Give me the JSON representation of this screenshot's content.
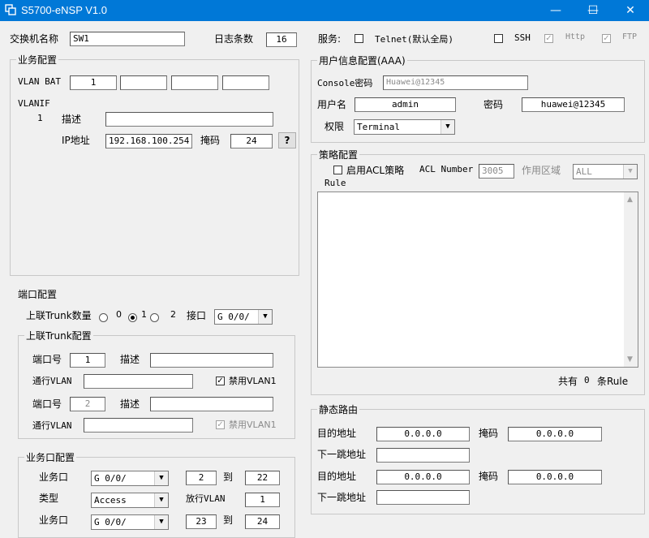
{
  "window": {
    "title": "S5700-eNSP V1.0",
    "minimize": "—",
    "maximize": "☐",
    "close": "✕"
  },
  "top": {
    "switch_name_label": "交换机名称",
    "switch_name_value": "SW1",
    "log_count_label": "日志条数",
    "log_count_value": "16",
    "services_label": "服务:",
    "telnet_label": "Telnet(默认全局)",
    "telnet_checked": false,
    "ssh_label": "SSH",
    "ssh_checked": false,
    "http_label": "Http",
    "http_checked": true,
    "ftp_label": "FTP",
    "ftp_checked": true
  },
  "business": {
    "title": "业务配置",
    "vlan_bat_label": "VLAN BAT",
    "vlan_bat_values": [
      "1",
      "",
      "",
      ""
    ],
    "vlanif_label": "VLANIF",
    "vlanif_number": "1",
    "desc_label": "描述",
    "desc_value": "",
    "ip_label": "IP地址",
    "ip_value": "192.168.100.254",
    "mask_label": "掩码",
    "mask_value": "24",
    "help_label": "?"
  },
  "port_config": {
    "title": "端口配置",
    "uplink_count_label": "上联Trunk数量",
    "options": [
      "0",
      "1",
      "2"
    ],
    "selected": "1",
    "port_label": "接口",
    "port_value": "G 0/0/"
  },
  "uplink_trunk": {
    "title": "上联Trunk配置",
    "rows": [
      {
        "port_label": "端口号",
        "port": "1",
        "desc_label": "描述",
        "desc": "",
        "allow_label": "通行VLAN",
        "allow": "",
        "disable_label": "禁用VLAN1",
        "disable_checked": true,
        "disabled": false
      },
      {
        "port_label": "端口号",
        "port": "2",
        "desc_label": "描述",
        "desc": "",
        "allow_label": "通行VLAN",
        "allow": "",
        "disable_label": "禁用VLAN1",
        "disable_checked": true,
        "disabled": true
      }
    ]
  },
  "service_port": {
    "title": "业务口配置",
    "port_label": "业务口",
    "port1": "G 0/0/",
    "from1": "2",
    "to_label": "到",
    "to1": "22",
    "type_label": "类型",
    "type_value": "Access",
    "pass_vlan_label": "放行VLAN",
    "pass_vlan": "1",
    "port2": "G 0/0/",
    "from2": "23",
    "to2": "24"
  },
  "aaa": {
    "title": "用户信息配置(AAA)",
    "console_label": "Console密码",
    "console_value": "Huawei@12345",
    "user_label": "用户名",
    "user_value": "admin",
    "pwd_label": "密码",
    "pwd_value": "huawei@12345",
    "priv_label": "权限",
    "priv_value": "Terminal"
  },
  "policy": {
    "title": "策略配置",
    "enable_acl_label": "启用ACL策略",
    "enable_acl_checked": false,
    "acl_number_label": "ACL Number",
    "acl_number_value": "3005",
    "scope_label": "作用区域",
    "scope_value": "ALL",
    "rule_label": "Rule",
    "total_prefix": "共有",
    "total_count": "0",
    "total_suffix": "条Rule"
  },
  "static_route": {
    "title": "静态路由",
    "dest_label": "目的地址",
    "dest1": "0.0.0.0",
    "mask_label": "掩码",
    "mask1": "0.0.0.0",
    "next_hop_label": "下一跳地址",
    "next_hop1": "",
    "dest2": "0.0.0.0",
    "mask2": "0.0.0.0",
    "next_hop2": ""
  },
  "icons": {
    "app": "app-icon",
    "dropdown": "chevron-down-icon",
    "scroll_up": "scroll-up-icon",
    "scroll_down": "scroll-down-icon"
  },
  "colors": {
    "titlebar": "#0078d7",
    "background": "#f0f0f0"
  }
}
